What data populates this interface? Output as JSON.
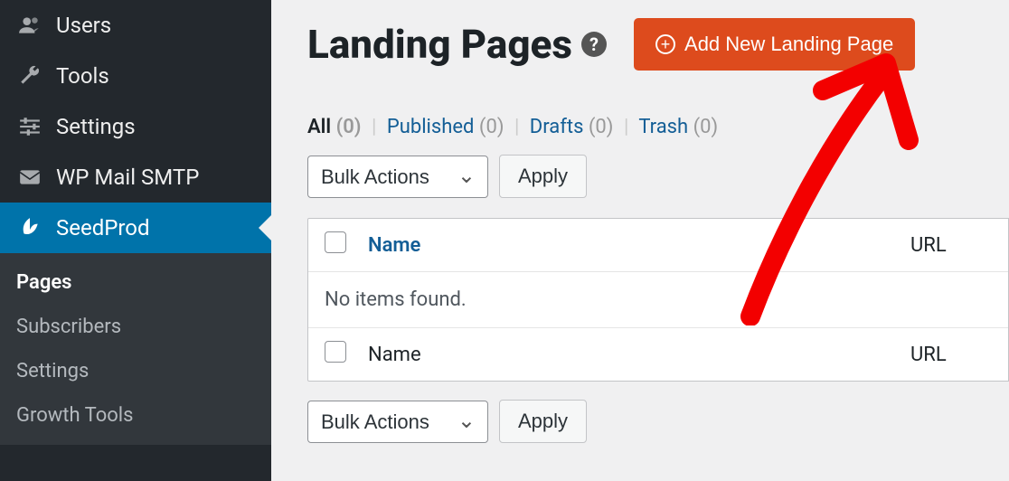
{
  "sidebar": {
    "items": [
      {
        "label": "Users",
        "icon": "users"
      },
      {
        "label": "Tools",
        "icon": "wrench"
      },
      {
        "label": "Settings",
        "icon": "sliders"
      },
      {
        "label": "WP Mail SMTP",
        "icon": "mail"
      },
      {
        "label": "SeedProd",
        "icon": "leaf",
        "active": true
      }
    ],
    "subitems": [
      {
        "label": "Pages",
        "current": true
      },
      {
        "label": "Subscribers"
      },
      {
        "label": "Settings"
      },
      {
        "label": "Growth Tools"
      }
    ]
  },
  "header": {
    "title": "Landing Pages",
    "help": "?",
    "add_button": "Add New Landing Page"
  },
  "filters": {
    "all": {
      "label": "All",
      "count": "(0)"
    },
    "published": {
      "label": "Published",
      "count": "(0)"
    },
    "drafts": {
      "label": "Drafts",
      "count": "(0)"
    },
    "trash": {
      "label": "Trash",
      "count": "(0)"
    }
  },
  "bulk": {
    "label": "Bulk Actions",
    "apply": "Apply"
  },
  "table": {
    "name_header": "Name",
    "url_header": "URL",
    "empty": "No items found.",
    "name_footer": "Name",
    "url_footer": "URL"
  }
}
